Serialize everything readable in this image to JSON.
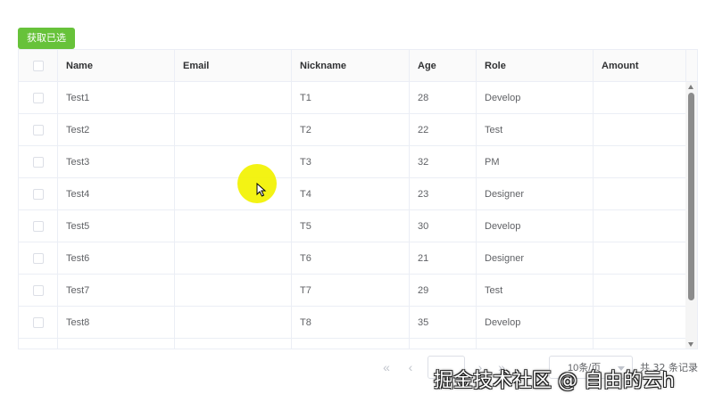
{
  "toolbar": {
    "get_selected_label": "获取已选"
  },
  "table": {
    "columns": [
      "Name",
      "Email",
      "Nickname",
      "Age",
      "Role",
      "Amount"
    ],
    "rows": [
      {
        "name": "Test1",
        "email": "",
        "nickname": "T1",
        "age": "28",
        "role": "Develop",
        "amount": ""
      },
      {
        "name": "Test2",
        "email": "",
        "nickname": "T2",
        "age": "22",
        "role": "Test",
        "amount": ""
      },
      {
        "name": "Test3",
        "email": "",
        "nickname": "T3",
        "age": "32",
        "role": "PM",
        "amount": ""
      },
      {
        "name": "Test4",
        "email": "",
        "nickname": "T4",
        "age": "23",
        "role": "Designer",
        "amount": ""
      },
      {
        "name": "Test5",
        "email": "",
        "nickname": "T5",
        "age": "30",
        "role": "Develop",
        "amount": ""
      },
      {
        "name": "Test6",
        "email": "",
        "nickname": "T6",
        "age": "21",
        "role": "Designer",
        "amount": ""
      },
      {
        "name": "Test7",
        "email": "",
        "nickname": "T7",
        "age": "29",
        "role": "Test",
        "amount": ""
      },
      {
        "name": "Test8",
        "email": "",
        "nickname": "T8",
        "age": "35",
        "role": "Develop",
        "amount": ""
      }
    ]
  },
  "pager": {
    "first_icon": "double-chevron-left-icon",
    "prev_icon": "chevron-left-icon",
    "current_page": "",
    "next_icon": "chevron-right-icon",
    "last_icon": "double-chevron-right-icon",
    "page_size": "10条/页",
    "total": "共 32 条记录"
  },
  "watermark": "掘金技术社区 @ 自由的云h",
  "colors": {
    "primary_button": "#67c23a",
    "border": "#ebeef5",
    "header_bg": "#fafafa",
    "highlight": "#f2f200"
  }
}
